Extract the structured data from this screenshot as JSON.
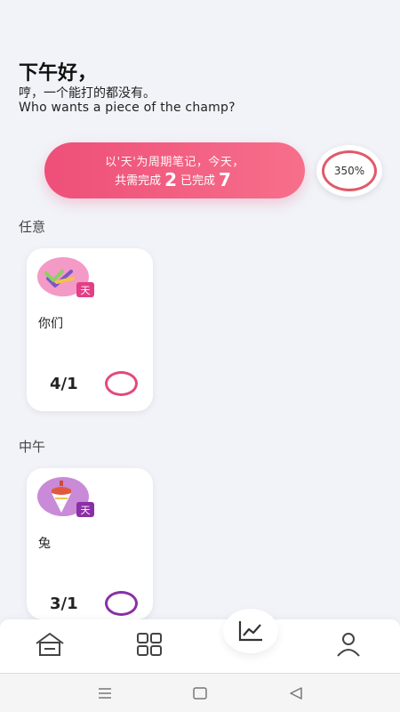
{
  "header": {
    "greeting": "下午好，",
    "subtitle_cn": "哼，一个能打的都没有。",
    "subtitle_en": "Who wants a piece of the champ?"
  },
  "banner": {
    "line1": "以'天'为周期笔记，今天，",
    "line2_prefix": "共需完成",
    "required": "2",
    "line2_middle": "已完成",
    "completed": "7"
  },
  "progress": {
    "percent_label": "350%",
    "ring_color": "#e05a6a"
  },
  "sections": [
    {
      "title": "任意",
      "card": {
        "name": "你们",
        "count": "4/1",
        "badge": "天",
        "icon": "checkmark-icon",
        "blob_color": "#f39ac6",
        "badge_color": "#e23f86",
        "ring_color": "#e24a7b"
      }
    },
    {
      "title": "中午",
      "card": {
        "name": "兔",
        "count": "3/1",
        "badge": "天",
        "icon": "spinning-top-icon",
        "blob_color": "#c98ad8",
        "badge_color": "#8a2fa6",
        "ring_color": "#8a2fa6"
      }
    }
  ],
  "tabbar": {
    "items": [
      "home-icon",
      "grid-icon",
      "chart-icon",
      "user-icon"
    ],
    "active": "chart-icon",
    "icon_color": "#444444"
  },
  "system_nav": {
    "items": [
      "menu-icon",
      "home-square-icon",
      "back-icon"
    ]
  }
}
